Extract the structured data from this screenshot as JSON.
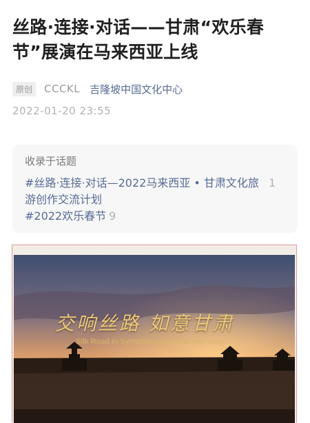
{
  "article": {
    "title": "丝路·连接·对话——甘肃“欢乐春节”展演在马来西亚上线",
    "tag": "原创",
    "account": "CCCKL",
    "source": "吉隆坡中国文化中心",
    "date": "2022-01-20 23:55"
  },
  "topics": {
    "heading": "收录于话题",
    "items": [
      {
        "label": "#丝路·连接·对话—2022马来西亚 • 甘肃文化旅游创作交流计划",
        "count": "1"
      },
      {
        "label": "#2022欢乐春节",
        "count": "9"
      }
    ]
  },
  "image": {
    "calligraphy": "交响丝路 如意甘肃",
    "subtitle": "Silk Road in Symphony,Gansu in Harmony.",
    "colors": {
      "sky_top": "#4a5a7a",
      "sunset": "#e9a25a",
      "ground": "#2a1d16"
    }
  }
}
